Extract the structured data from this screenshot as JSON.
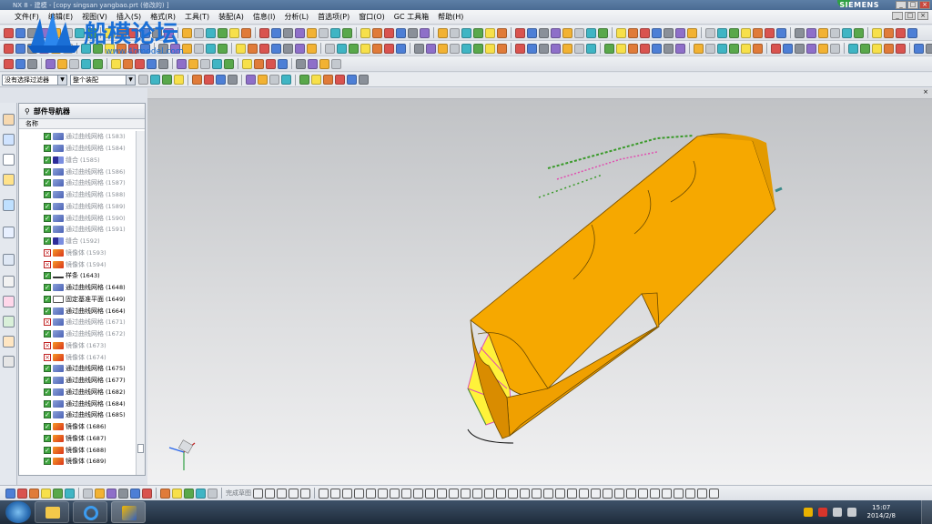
{
  "window": {
    "title": "NX 8 - 建模 - [copy singsan yangbao.prt  (修改的) ]",
    "brand": "SIEMENS",
    "min": "_",
    "max": "□",
    "close": "×"
  },
  "menu": [
    "文件(F)",
    "编辑(E)",
    "视图(V)",
    "插入(S)",
    "格式(R)",
    "工具(T)",
    "装配(A)",
    "信息(I)",
    "分析(L)",
    "首选项(P)",
    "窗口(O)",
    "GC 工具箱",
    "帮助(H)"
  ],
  "watermark": {
    "title": "船模论坛",
    "url": "www.4hmodel.com"
  },
  "selection_bar": {
    "filter": "没有选择过滤器",
    "scope": "整个装配"
  },
  "navigator": {
    "title": "部件导航器",
    "column": "名称",
    "rows": [
      {
        "state": "on",
        "icon": "mesh",
        "name": "通过曲线网格",
        "id": "(1583)",
        "dim": true
      },
      {
        "state": "on",
        "icon": "mesh",
        "name": "通过曲线网格",
        "id": "(1584)",
        "dim": true
      },
      {
        "state": "on",
        "icon": "sew",
        "name": "缝合",
        "id": "(1585)",
        "dim": true
      },
      {
        "state": "on",
        "icon": "mesh",
        "name": "通过曲线网格",
        "id": "(1586)",
        "dim": true
      },
      {
        "state": "on",
        "icon": "mesh",
        "name": "通过曲线网格",
        "id": "(1587)",
        "dim": true
      },
      {
        "state": "on",
        "icon": "mesh",
        "name": "通过曲线网格",
        "id": "(1588)",
        "dim": true
      },
      {
        "state": "on",
        "icon": "mesh",
        "name": "通过曲线网格",
        "id": "(1589)",
        "dim": true
      },
      {
        "state": "on",
        "icon": "mesh",
        "name": "通过曲线网格",
        "id": "(1590)",
        "dim": true
      },
      {
        "state": "on",
        "icon": "mesh",
        "name": "通过曲线网格",
        "id": "(1591)",
        "dim": true
      },
      {
        "state": "on",
        "icon": "sew",
        "name": "缝合",
        "id": "(1592)",
        "dim": true
      },
      {
        "state": "off",
        "icon": "mir",
        "name": "镜像体",
        "id": "(1593)",
        "dim": true
      },
      {
        "state": "off",
        "icon": "mir",
        "name": "镜像体",
        "id": "(1594)",
        "dim": true
      },
      {
        "state": "on",
        "icon": "spl",
        "name": "样条",
        "id": "(1643)",
        "dim": false
      },
      {
        "state": "on",
        "icon": "mesh",
        "name": "通过曲线网格",
        "id": "(1648)",
        "dim": false
      },
      {
        "state": "on",
        "icon": "pln",
        "name": "固定基准平面",
        "id": "(1649)",
        "dim": false
      },
      {
        "state": "on",
        "icon": "mesh",
        "name": "通过曲线网格",
        "id": "(1664)",
        "dim": false
      },
      {
        "state": "off",
        "icon": "mesh",
        "name": "通过曲线网格",
        "id": "(1671)",
        "dim": true
      },
      {
        "state": "on",
        "icon": "mesh",
        "name": "通过曲线网格",
        "id": "(1672)",
        "dim": true
      },
      {
        "state": "off",
        "icon": "mir",
        "name": "镜像体",
        "id": "(1673)",
        "dim": true
      },
      {
        "state": "off",
        "icon": "mir",
        "name": "镜像体",
        "id": "(1674)",
        "dim": true
      },
      {
        "state": "on",
        "icon": "mesh",
        "name": "通过曲线网格",
        "id": "(1675)",
        "dim": false
      },
      {
        "state": "on",
        "icon": "mesh",
        "name": "通过曲线网格",
        "id": "(1677)",
        "dim": false
      },
      {
        "state": "on",
        "icon": "mesh",
        "name": "通过曲线网格",
        "id": "(1682)",
        "dim": false
      },
      {
        "state": "on",
        "icon": "mesh",
        "name": "通过曲线网格",
        "id": "(1684)",
        "dim": false
      },
      {
        "state": "on",
        "icon": "mesh",
        "name": "通过曲线网格",
        "id": "(1685)",
        "dim": false
      },
      {
        "state": "on",
        "icon": "mir",
        "name": "镜像体",
        "id": "(1686)",
        "dim": false
      },
      {
        "state": "on",
        "icon": "mir",
        "name": "镜像体",
        "id": "(1687)",
        "dim": false
      },
      {
        "state": "on",
        "icon": "mir",
        "name": "镜像体",
        "id": "(1688)",
        "dim": false
      },
      {
        "state": "on",
        "icon": "mir",
        "name": "镜像体",
        "id": "(1689)",
        "dim": false
      }
    ]
  },
  "bottom_toolbar": {
    "finish_sketch": "完成草图"
  },
  "taskbar": {
    "time": "15:07",
    "date": "2014/2/8"
  },
  "colors": {
    "hull": "#f6a800",
    "hull_dark": "#d98c00",
    "mesh_green": "#3a9a2a",
    "mesh_pink": "#e04fb0",
    "mesh_yellow": "#fff23a"
  }
}
